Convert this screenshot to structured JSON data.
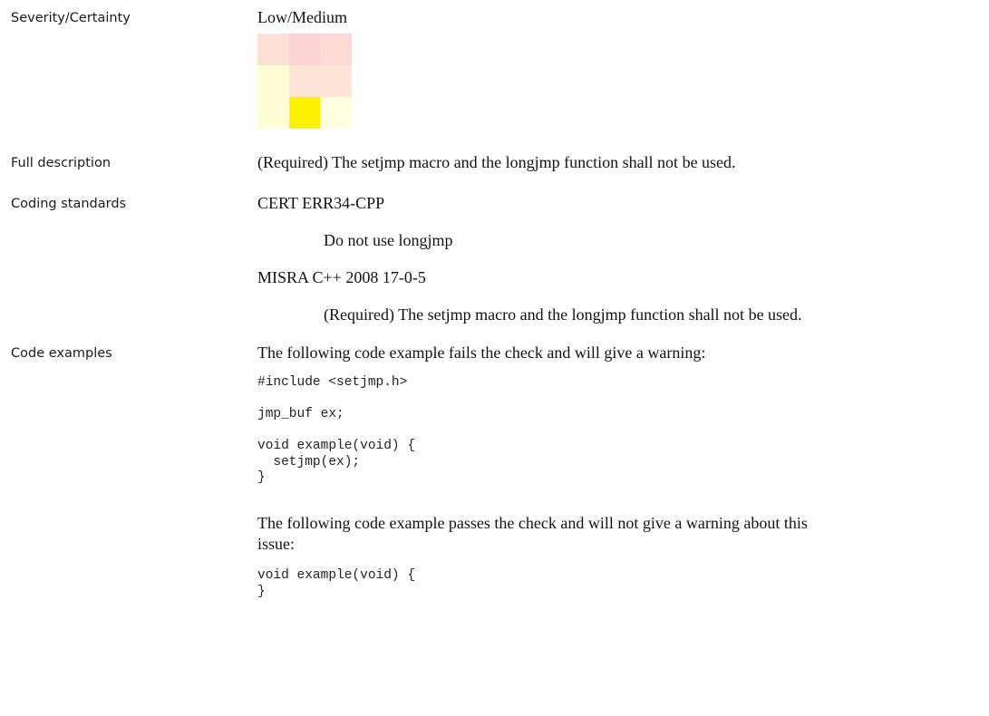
{
  "rows": {
    "severity": {
      "label": "Severity/Certainty",
      "value": "Low/Medium",
      "matrix": [
        "#fde0d4",
        "#fdd2d4",
        "#fdd9d6",
        "#fffed6",
        "#fde6d8",
        "#fde4d6",
        "#fffed6",
        "#fff200",
        "#fffede"
      ]
    },
    "full_description": {
      "label": "Full description",
      "text": "(Required) The setjmp macro and the longjmp function shall not be used."
    },
    "coding_standards": {
      "label": "Coding standards",
      "items": [
        {
          "name": "CERT ERR34-CPP",
          "description": "Do not use longjmp"
        },
        {
          "name": "MISRA C++ 2008 17-0-5",
          "description": "(Required) The setjmp macro and the longjmp function shall not be used."
        }
      ]
    },
    "code_examples": {
      "label": "Code examples",
      "fail_intro": "The following code example fails the check and will give a warning:",
      "fail_code": "#include <setjmp.h>\n\njmp_buf ex;\n\nvoid example(void) {\n  setjmp(ex);\n}",
      "pass_intro_line1": "The following code example passes the check and will not give a warning about this",
      "pass_intro_line2": "issue:",
      "pass_code": "void example(void) {\n}"
    }
  }
}
